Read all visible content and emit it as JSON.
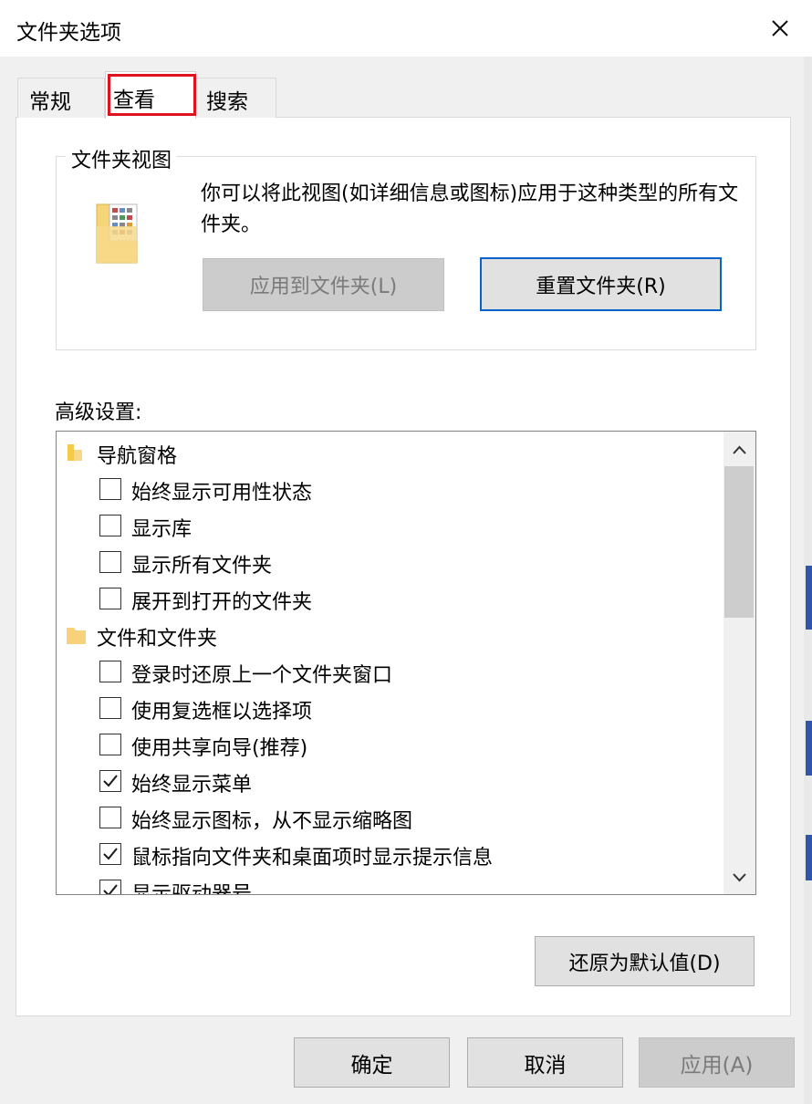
{
  "window": {
    "title": "文件夹选项"
  },
  "tabs": [
    {
      "label": "常规"
    },
    {
      "label": "查看"
    },
    {
      "label": "搜索"
    }
  ],
  "folder_views": {
    "group_label": "文件夹视图",
    "description": "你可以将此视图(如详细信息或图标)应用于这种类型的所有文件夹。",
    "apply_button": "应用到文件夹(L)",
    "reset_button": "重置文件夹(R)"
  },
  "advanced": {
    "label": "高级设置:",
    "items": [
      {
        "type": "category",
        "label": "导航窗格",
        "icon": "navigation-pane-icon"
      },
      {
        "type": "option",
        "label": "始终显示可用性状态",
        "checked": false
      },
      {
        "type": "option",
        "label": "显示库",
        "checked": false
      },
      {
        "type": "option",
        "label": "显示所有文件夹",
        "checked": false
      },
      {
        "type": "option",
        "label": "展开到打开的文件夹",
        "checked": false
      },
      {
        "type": "category",
        "label": "文件和文件夹",
        "icon": "folder-icon"
      },
      {
        "type": "option",
        "label": "登录时还原上一个文件夹窗口",
        "checked": false
      },
      {
        "type": "option",
        "label": "使用复选框以选择项",
        "checked": false
      },
      {
        "type": "option",
        "label": "使用共享向导(推荐)",
        "checked": false
      },
      {
        "type": "option",
        "label": "始终显示菜单",
        "checked": true
      },
      {
        "type": "option",
        "label": "始终显示图标，从不显示缩略图",
        "checked": false
      },
      {
        "type": "option",
        "label": "鼠标指向文件夹和桌面项时显示提示信息",
        "checked": true
      },
      {
        "type": "option",
        "label": "显示驱动器号",
        "checked": true
      }
    ],
    "restore_defaults_button": "还原为默认值(D)"
  },
  "footer": {
    "ok_button": "确定",
    "cancel_button": "取消",
    "apply_button": "应用(A)"
  },
  "colors": {
    "highlight_box": "#e0121e",
    "default_button_border": "#0a63c9",
    "checkbox_check": "#1a1a1a"
  }
}
